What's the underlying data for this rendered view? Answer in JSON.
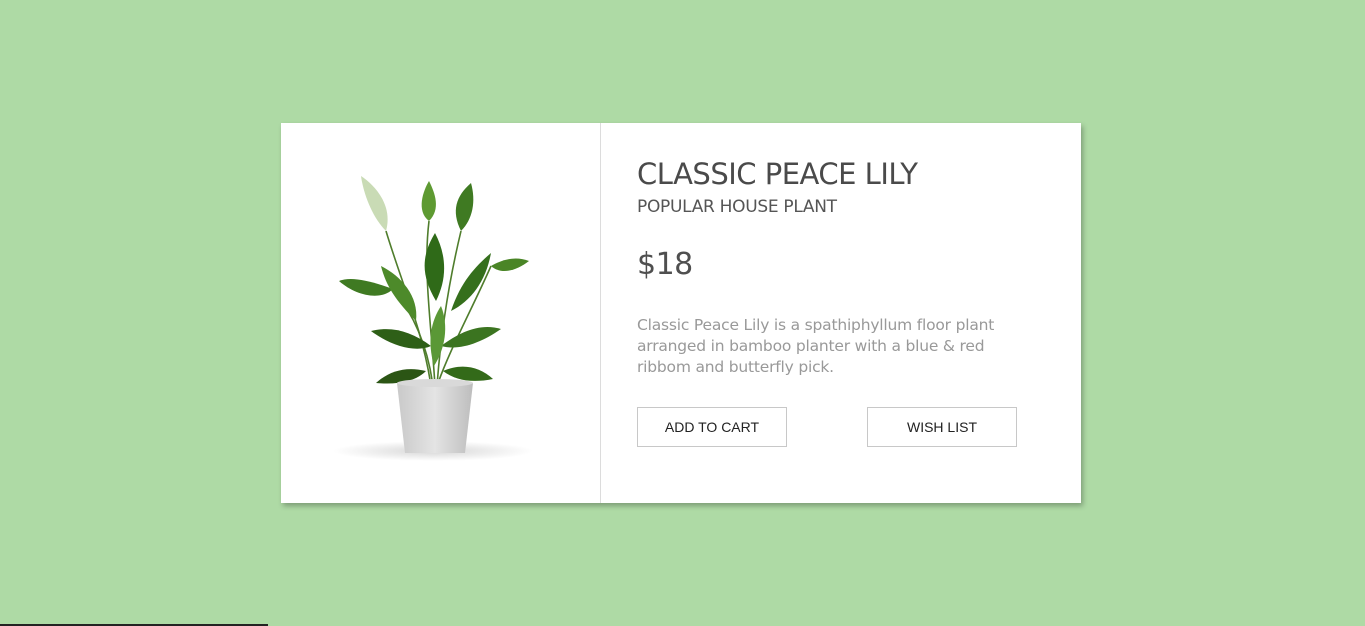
{
  "product": {
    "title": "CLASSIC PEACE LILY",
    "subtitle": "POPULAR HOUSE PLANT",
    "price": "$18",
    "description": "Classic Peace Lily is a spathiphyllum floor plant arranged in bamboo planter with a blue & red ribbom and butterfly pick.",
    "image_icon": "peace-lily-plant-photo"
  },
  "actions": {
    "add_to_cart_label": "ADD TO CART",
    "wish_list_label": "WISH LIST"
  },
  "colors": {
    "page_background": "#aedaa5",
    "card_background": "#ffffff",
    "title_text": "#4a4a4a",
    "description_text": "#999999",
    "button_border": "#c8c8c8"
  }
}
